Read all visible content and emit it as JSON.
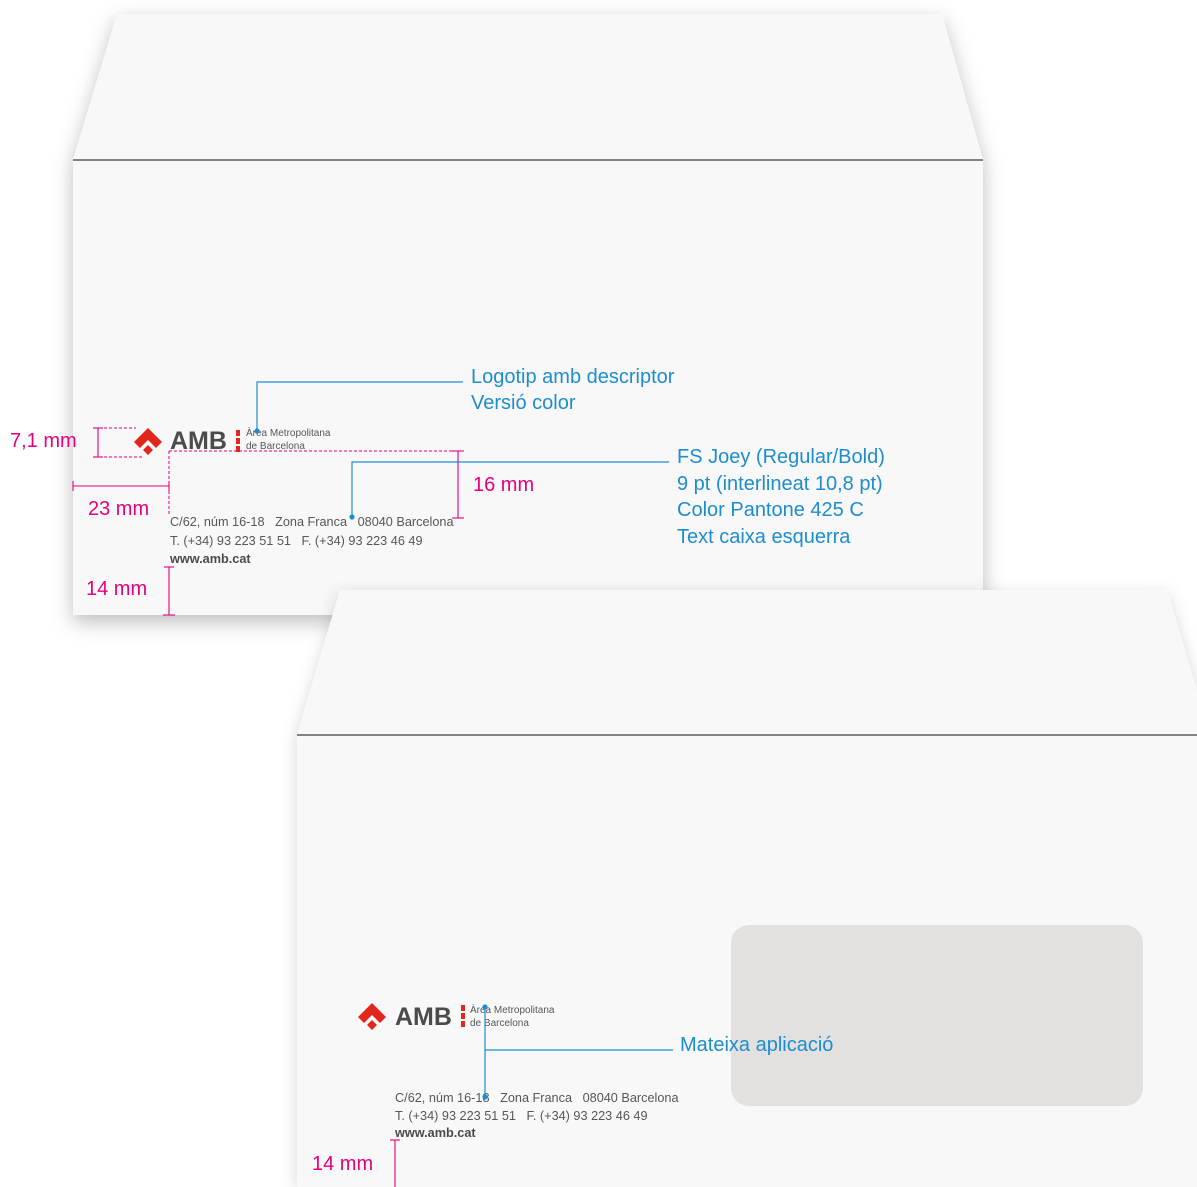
{
  "colors": {
    "annotation": "#1d8dcd",
    "measurement": "#e5007d",
    "logo_mark": "#e3261c",
    "wordmark": "#4b4b4b",
    "body_text": "#575757",
    "envelope": "#f8f8f8",
    "window": "#e2e1df",
    "fold_line": "#3d3d3d"
  },
  "icons": {
    "logo_mark": "amb-logo-icon",
    "descriptor_separator": "dotted-separator-icon"
  },
  "envelope_plain": {
    "logo": {
      "wordmark": "AMB",
      "descriptor": [
        "Àrea Metropolitana",
        "de Barcelona"
      ]
    },
    "address": {
      "street": "C/62, núm 16-18   Zona Franca   08040 Barcelona",
      "phone_fax": "T. (+34) 93 223 51 51   F. (+34) 93 223 46 49",
      "web": "www.amb.cat"
    },
    "callouts": {
      "logo": [
        "Logotip amb descriptor",
        "Versió color"
      ],
      "typography": [
        "FS Joey (Regular/Bold)",
        "9 pt (interlineat 10,8 pt)",
        "Color Pantone 425 C",
        "Text caixa esquerra"
      ]
    },
    "measurements": {
      "logo_height": "7,1 mm",
      "left_margin": "23 mm",
      "logo_to_address": "16 mm",
      "bottom_margin": "14 mm"
    }
  },
  "envelope_window": {
    "logo": {
      "wordmark": "AMB",
      "descriptor": [
        "Àrea Metropolitana",
        "de Barcelona"
      ]
    },
    "address": {
      "street": "C/62, núm 16-18   Zona Franca   08040 Barcelona",
      "phone_fax": "T. (+34) 93 223 51 51   F. (+34) 93 223 46 49",
      "web": "www.amb.cat"
    },
    "callouts": {
      "layout": "Mateixa aplicació"
    },
    "measurements": {
      "bottom_margin": "14 mm"
    }
  }
}
